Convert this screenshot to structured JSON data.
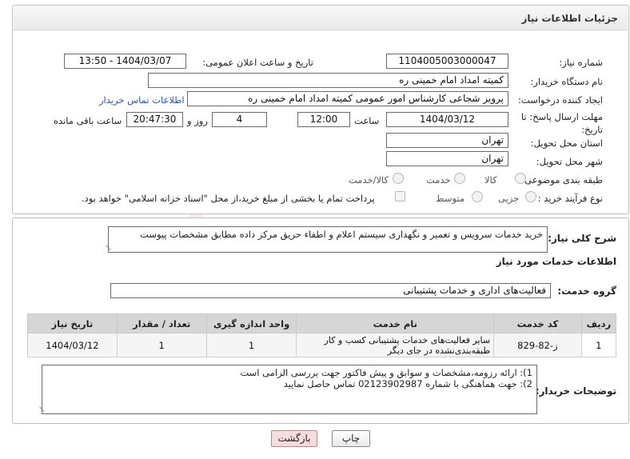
{
  "header": {
    "title": "جزئیات اطلاعات نیاز"
  },
  "form": {
    "need_number_label": "شماره نیاز:",
    "need_number": "1104005003000047",
    "announce_label": "تاریخ و ساعت اعلان عمومی:",
    "announce_value": "1404/03/07 - 13:50",
    "buyer_label": "نام دستگاه خریدار:",
    "buyer_value": "کمیته امداد امام خمینی ره",
    "creator_label": "ایجاد کننده درخواست:",
    "creator_value": "پرویز شجاعی کارشناس امور عمومی کمیته امداد امام خمینی ره",
    "contact_link": "اطلاعات تماس خریدار",
    "deadline_label": "مهلت ارسال پاسخ: تا تاریخ:",
    "deadline_date": "1404/03/12",
    "time_label": "ساعت",
    "deadline_time": "12:00",
    "days_value": "4",
    "days_label": "روز و",
    "remaining_time": "20:47:30",
    "remaining_label": "ساعت باقی مانده",
    "province_label": "استان محل تحویل:",
    "province_value": "تهران",
    "city_label": "شهر محل تحویل:",
    "city_value": "تهران",
    "category_label": "طبقه بندی موضوعی:",
    "category_options": [
      "کالا",
      "خدمت",
      "کالا/خدمت"
    ],
    "process_label": "نوع فرآیند خرید :",
    "process_options": [
      "جزیی",
      "متوسط"
    ],
    "payment_note": "پرداخت تمام یا بخشی از مبلغ خرید،از محل \"اسناد خزانه اسلامی\" خواهد بود."
  },
  "description": {
    "label": "شرح کلی نیاز:",
    "value": "خرید خدمات سرویس و تعمیر و نگهداری سیستم اعلام و اطفاء حریق مرکز داده مطابق مشخصات پیوست"
  },
  "services": {
    "section_title": "اطلاعات خدمات مورد نیاز",
    "group_label": "گروه خدمت:",
    "group_value": "فعالیت‌های اداری و خدمات پشتیبانی",
    "table": {
      "headers": [
        "ردیف",
        "کد خدمت",
        "نام خدمت",
        "واحد اندازه گیری",
        "تعداد / مقدار",
        "تاریخ نیاز"
      ],
      "rows": [
        [
          "1",
          "ز-82-829",
          "سایر فعالیت‌های خدمات پشتیبانی کسب و کار طبقه‌بندی‌نشده در جای دیگر",
          "1",
          "1",
          "1404/03/12"
        ]
      ]
    }
  },
  "buyer_notes": {
    "label": "توضیحات خریدار:",
    "line1": "1): ارائه رزومه،مشخصات و سوابق و پیش فاکتور جهت بررسی الزامی است",
    "line2": "2): جهت هماهنگی با شماره 02123902987 تماس حاصل نمایید"
  },
  "buttons": {
    "print": "چاپ",
    "back": "بازگشت"
  },
  "watermark": {
    "text": "AriaTender.net"
  },
  "colors": {
    "link": "#2a55b5",
    "back_button_bg": "#f6dcdc",
    "watermark": "#c0392b"
  }
}
